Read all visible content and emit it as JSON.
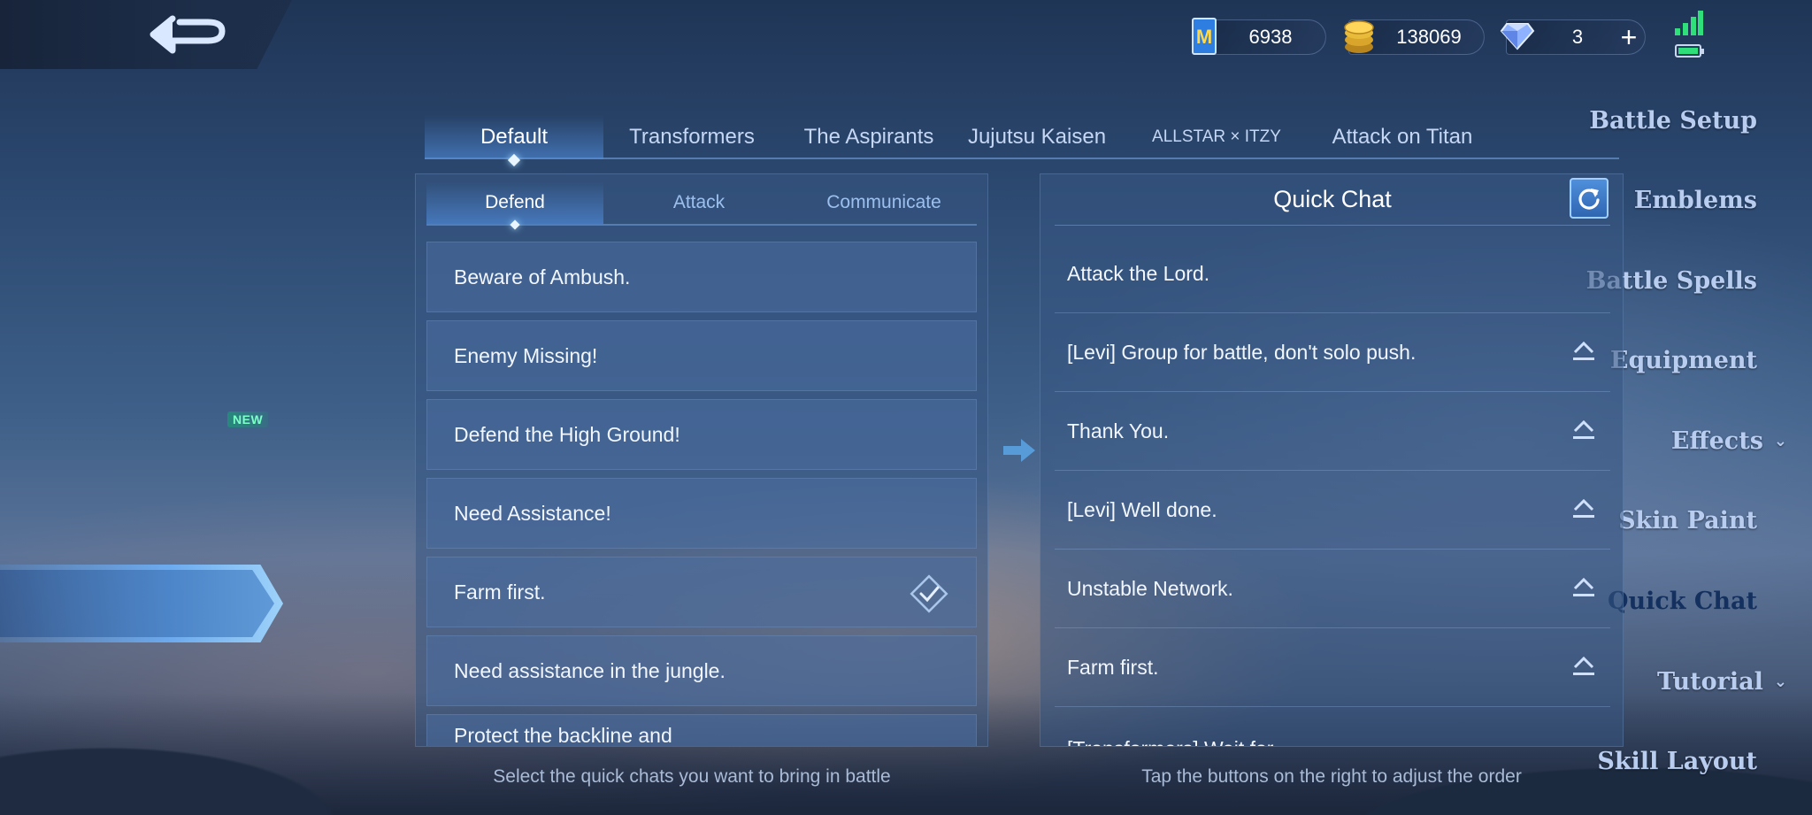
{
  "topbar": {
    "back_icon": "back-arrow-icon",
    "currencies": [
      {
        "name": "battle-points",
        "icon": "m-token-icon",
        "value": "6938"
      },
      {
        "name": "gold",
        "icon": "gold-coins-icon",
        "value": "138069"
      },
      {
        "name": "diamonds",
        "icon": "diamond-icon",
        "value": "3"
      }
    ],
    "plus_label": "+",
    "signal_color": "#2fe07a"
  },
  "sidebar": {
    "items": [
      {
        "label": "Battle Setup"
      },
      {
        "label": "Emblems"
      },
      {
        "label": "Battle Spells"
      },
      {
        "label": "Equipment"
      },
      {
        "label": "Effects",
        "chevron": "⌄"
      },
      {
        "label": "Skin Paint"
      },
      {
        "label": "Quick Chat",
        "active": true
      },
      {
        "label": "Tutorial",
        "chevron": "⌄"
      },
      {
        "label": "Skill Layout"
      }
    ],
    "new_badge": "NEW"
  },
  "theme_tabs": [
    {
      "label": "Default",
      "active": true
    },
    {
      "label": "Transformers"
    },
    {
      "label": "The Aspirants"
    },
    {
      "label": "Jujutsu Kaisen"
    },
    {
      "label": "ALLSTAR × ITZY"
    },
    {
      "label": "Attack on Titan"
    }
  ],
  "left_panel": {
    "sub_tabs": [
      {
        "label": "Defend",
        "active": true
      },
      {
        "label": "Attack"
      },
      {
        "label": "Communicate"
      }
    ],
    "chats": [
      {
        "text": "Beware of Ambush."
      },
      {
        "text": "Enemy Missing!"
      },
      {
        "text": "Defend the High Ground!"
      },
      {
        "text": "Need Assistance!"
      },
      {
        "text": "Farm first.",
        "selected": true
      },
      {
        "text": "Need assistance in the jungle."
      },
      {
        "text": "Protect the backline and"
      }
    ],
    "footer": "Select the quick chats you want to bring in battle"
  },
  "right_panel": {
    "title": "Quick Chat",
    "items": [
      {
        "text": "Attack the Lord."
      },
      {
        "text": "[Levi] Group for battle, don't solo push."
      },
      {
        "text": "Thank You."
      },
      {
        "text": "[Levi] Well done."
      },
      {
        "text": "Unstable Network."
      },
      {
        "text": "Farm first."
      },
      {
        "text": "[Transformers] Wait for"
      }
    ],
    "footer": "Tap the buttons on the right to adjust the order"
  },
  "colors": {
    "accent": "#6fb4ff",
    "panel": "#37557f",
    "badge": "#7dffc8"
  }
}
